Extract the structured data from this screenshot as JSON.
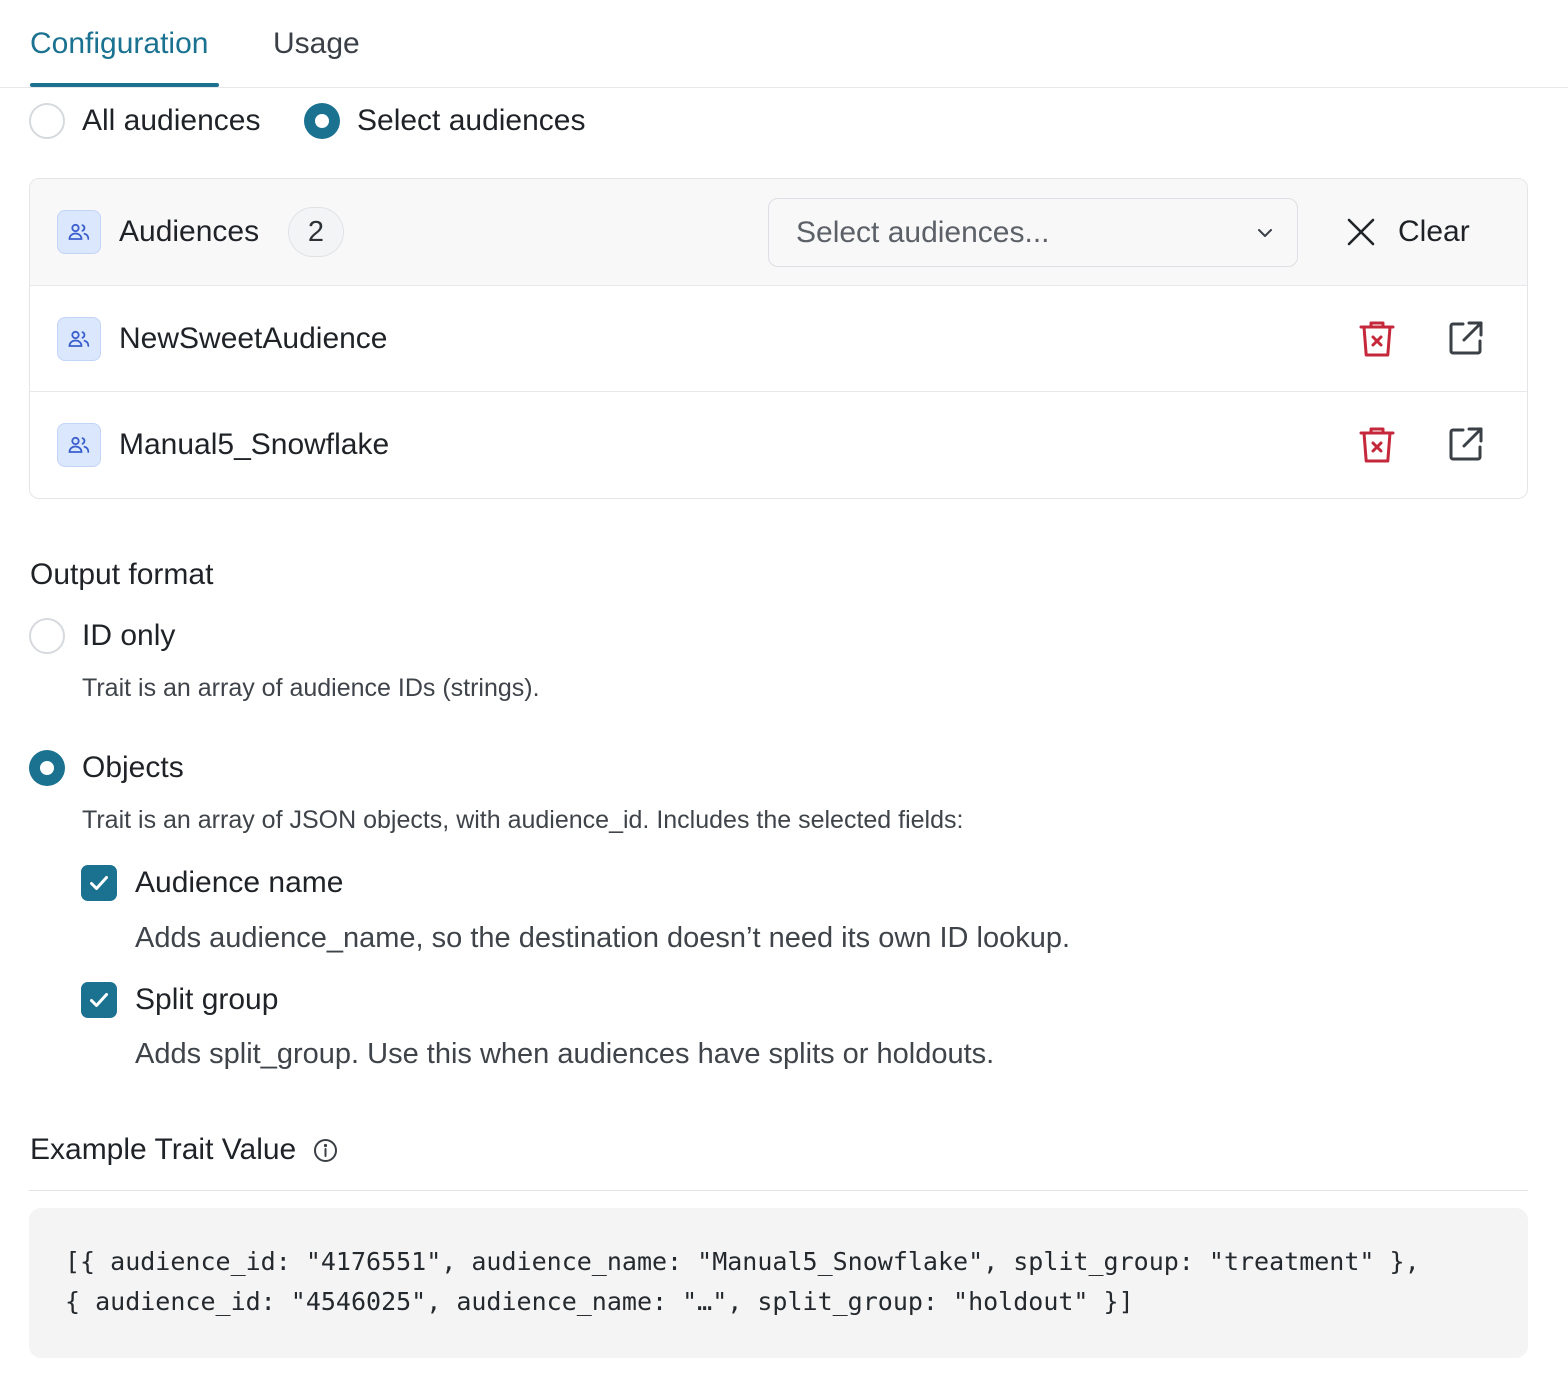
{
  "tabs": [
    {
      "label": "Configuration",
      "active": true
    },
    {
      "label": "Usage",
      "active": false
    }
  ],
  "audience_scope": {
    "options": [
      {
        "label": "All audiences",
        "checked": false
      },
      {
        "label": "Select audiences",
        "checked": true
      }
    ]
  },
  "audiences_card": {
    "title": "Audiences",
    "count": "2",
    "select_placeholder": "Select audiences...",
    "clear_label": "Clear",
    "items": [
      {
        "name": "NewSweetAudience"
      },
      {
        "name": "Manual5_Snowflake"
      }
    ]
  },
  "output_format": {
    "title": "Output format",
    "id_only": {
      "label": "ID only",
      "checked": false,
      "description": "Trait is an array of audience IDs (strings)."
    },
    "objects": {
      "label": "Objects",
      "checked": true,
      "description": "Trait is an array of JSON objects, with audience_id. Includes the selected fields:",
      "fields": [
        {
          "label": "Audience name",
          "checked": true,
          "description": "Adds audience_name, so the destination doesn’t need its own ID lookup."
        },
        {
          "label": "Split group",
          "checked": true,
          "description": "Adds split_group. Use this when audiences have splits or holdouts."
        }
      ]
    }
  },
  "example": {
    "title": "Example Trait Value",
    "code_lines": [
      "[{ audience_id: \"4176551\", audience_name: \"Manual5_Snowflake\", split_group: \"treatment\" },",
      "{ audience_id: \"4546025\", audience_name: \"…\", split_group: \"holdout\" }]"
    ]
  },
  "colors": {
    "accent": "#1a7290",
    "danger": "#c4283a",
    "icon_bg": "#dbe7fd",
    "icon_fg": "#3a5fcd"
  },
  "icons": {
    "audience": "audience-icon",
    "chevron": "chevron-down-icon",
    "clear": "close-icon",
    "delete": "trash-icon",
    "open": "external-link-icon",
    "info": "info-icon",
    "check": "check-icon"
  }
}
